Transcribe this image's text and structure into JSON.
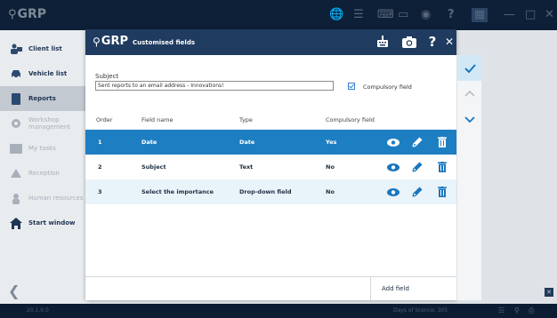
{
  "app": {
    "logo": "GRP",
    "version": "20.1.0.0",
    "license": "Days of licence: 305"
  },
  "sidebar": {
    "items": [
      {
        "label": "Client list",
        "icon": "clients-icon",
        "dim": false
      },
      {
        "label": "Vehicle list",
        "icon": "car-icon",
        "dim": false
      },
      {
        "label": "Reports",
        "icon": "reports-icon",
        "dim": false
      },
      {
        "label": "Workshop management",
        "icon": "workshop-icon",
        "dim": true
      },
      {
        "label": "My tasks",
        "icon": "tasks-icon",
        "dim": true
      },
      {
        "label": "Reception",
        "icon": "reception-icon",
        "dim": true
      },
      {
        "label": "Human resources",
        "icon": "hr-icon",
        "dim": true
      },
      {
        "label": "Start window",
        "icon": "home-icon",
        "dim": false
      }
    ]
  },
  "dialog": {
    "logo": "GRP",
    "title": "Customised fields",
    "subject_label": "Subject",
    "subject_value": "Sent reports to an email address - Innovations!",
    "compulsory_label": "Compulsory field",
    "compulsory_checked": true,
    "columns": {
      "order": "Order",
      "field_name": "Field name",
      "type": "Type",
      "compulsory": "Compulsory field"
    },
    "rows": [
      {
        "order": "1",
        "name": "Date",
        "type": "Date",
        "compulsory": "Yes",
        "selected": true
      },
      {
        "order": "2",
        "name": "Subject",
        "type": "Text",
        "compulsory": "No",
        "selected": false
      },
      {
        "order": "3",
        "name": "Select the importance",
        "type": "Drop-down field",
        "compulsory": "No",
        "selected": false
      }
    ],
    "add_field": "Add field"
  },
  "colors": {
    "header_navy": "#1f3b5f",
    "selected_row": "#1d7ec2",
    "accent_blue": "#1a76bd",
    "alt_row": "#e9f3fa"
  }
}
